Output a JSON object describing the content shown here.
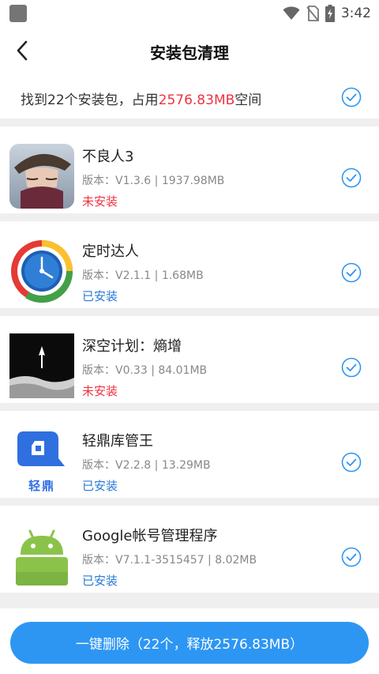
{
  "status_bar": {
    "time": "3:42"
  },
  "header": {
    "title": "安装包清理"
  },
  "summary": {
    "prefix": "找到22个安装包，占用",
    "size": "2576.83MB",
    "suffix": "空间"
  },
  "colors": {
    "accent": "#2d96f3",
    "not_installed": "#ee3340",
    "installed": "#2979d4"
  },
  "apps": [
    {
      "name": "不良人3",
      "meta": "版本：V1.3.6 | 1937.98MB",
      "status": "未安装",
      "installed": false,
      "icon": "buliangren-game-icon"
    },
    {
      "name": "定时达人",
      "meta": "版本：V2.1.1 | 1.68MB",
      "status": "已安装",
      "installed": true,
      "icon": "clock-app-icon"
    },
    {
      "name": "深空计划：熵增",
      "meta": "版本：V0.33 | 84.01MB",
      "status": "未安装",
      "installed": false,
      "icon": "deep-space-game-icon"
    },
    {
      "name": "轻鼎库管王",
      "meta": "版本：V2.2.8 | 13.29MB",
      "status": "已安装",
      "installed": true,
      "icon": "qingding-app-icon",
      "icon_caption": "轻鼎"
    },
    {
      "name": "Google帐号管理程序",
      "meta": "版本：V7.1.1-3515457 | 8.02MB",
      "status": "已安装",
      "installed": true,
      "icon": "android-robot-icon"
    }
  ],
  "action": {
    "delete_label": "一键删除（22个，释放2576.83MB）"
  }
}
